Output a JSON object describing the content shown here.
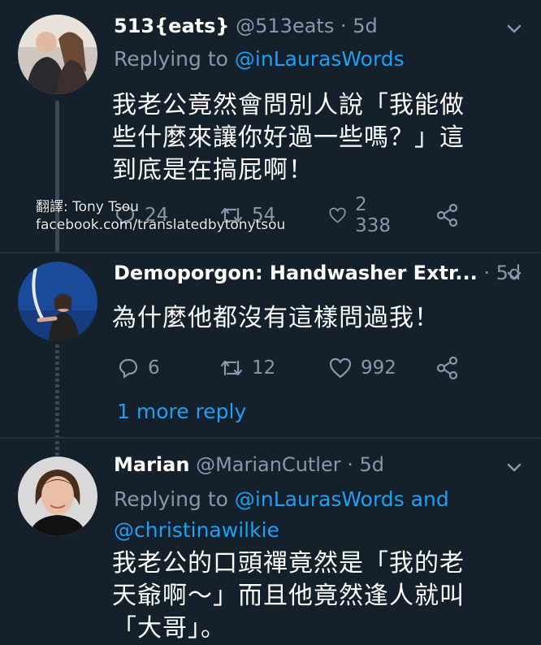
{
  "watermark": {
    "line1": "翻譯: Tony Tsou",
    "line2": "facebook.com/translatedbytonytsou"
  },
  "tweets": [
    {
      "name": "513{eats}",
      "handle": "@513eats",
      "time": "· 5d",
      "replying_prefix": "Replying to",
      "replying_to": "@inLaurasWords",
      "text_lines": [
        "我老公竟然會問別人說「我能做",
        "些什麼來讓你好過一些嗎？」這",
        "到底是在搞屁啊！"
      ],
      "replies": "24",
      "retweets": "54",
      "likes": "2 338"
    },
    {
      "name": "Demoporgon: Handwasher Extr...",
      "handle": "",
      "time": "· 5d",
      "text_lines": [
        "為什麼他都沒有這樣問過我！"
      ],
      "replies": "6",
      "retweets": "12",
      "likes": "992",
      "more_replies": "1 more reply"
    },
    {
      "name": "Marian",
      "handle": "@MarianCutler",
      "time": "· 5d",
      "replying_prefix": "Replying to",
      "replying_to": "@inLaurasWords",
      "replying_and": "and",
      "replying_to2": "@christinawilkie",
      "text_lines": [
        "我老公的口頭禪竟然是「我的老",
        "天爺啊～」而且他竟然逢人就叫",
        "「大哥」。"
      ]
    }
  ],
  "colors": {
    "background": "#14202b",
    "link": "#1da1f2",
    "muted": "#8899a6"
  }
}
